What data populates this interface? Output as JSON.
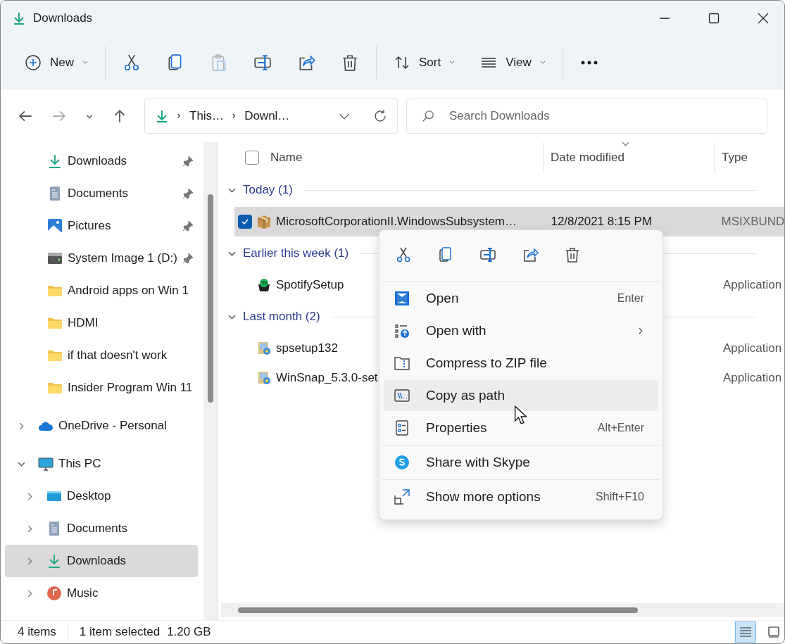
{
  "window": {
    "title": "Downloads"
  },
  "toolbar": {
    "new_label": "New",
    "sort_label": "Sort",
    "view_label": "View",
    "actions": [
      {
        "kind": "cut",
        "disabled": false
      },
      {
        "kind": "copy",
        "disabled": false
      },
      {
        "kind": "paste",
        "disabled": true
      },
      {
        "kind": "rename",
        "disabled": false
      },
      {
        "kind": "share",
        "disabled": false
      },
      {
        "kind": "delete",
        "disabled": false
      }
    ]
  },
  "address": {
    "crumbs": [
      "This…",
      "Downl…"
    ],
    "search_placeholder": "Search Downloads"
  },
  "sidebar": {
    "items": [
      {
        "label": "Downloads",
        "kind": "downloads",
        "pinned": true,
        "selected": false
      },
      {
        "label": "Documents",
        "kind": "documents",
        "pinned": true,
        "selected": false
      },
      {
        "label": "Pictures",
        "kind": "pictures",
        "pinned": true,
        "selected": false
      },
      {
        "label": "System Image 1 (D:)",
        "kind": "drive",
        "pinned": true,
        "selected": false
      },
      {
        "label": "Android apps on Win 1",
        "kind": "folder",
        "pinned": false,
        "selected": false
      },
      {
        "label": "HDMI",
        "kind": "folder",
        "pinned": false,
        "selected": false
      },
      {
        "label": "if that doesn't work",
        "kind": "folder",
        "pinned": false,
        "selected": false
      },
      {
        "label": "Insider Program Win 11",
        "kind": "folder",
        "pinned": false,
        "selected": false
      },
      {
        "label": "OneDrive - Personal",
        "kind": "cloud",
        "expanded": false,
        "selected": false
      },
      {
        "label": "This PC",
        "kind": "pc",
        "expanded": true,
        "selected": false,
        "children": [
          {
            "label": "Desktop",
            "kind": "desktop",
            "expanded": false,
            "selected": false
          },
          {
            "label": "Documents",
            "kind": "documents",
            "expanded": false,
            "selected": false
          },
          {
            "label": "Downloads",
            "kind": "downloads",
            "expanded": false,
            "selected": true
          },
          {
            "label": "Music",
            "kind": "music",
            "expanded": false,
            "selected": false
          }
        ]
      }
    ]
  },
  "columns": [
    "Name",
    "Date modified",
    "Type"
  ],
  "select_all": {
    "checked": false
  },
  "groups": [
    {
      "label": "Today (1)",
      "expanded": true,
      "files": [
        {
          "name": "MicrosoftCorporationII.WindowsSubsystem…",
          "date": "12/8/2021 8:15 PM",
          "type": "MSIXBUND",
          "kind": "package",
          "selected": true
        }
      ]
    },
    {
      "label": "Earlier this week (1)",
      "expanded": true,
      "files": [
        {
          "name": "SpotifySetup",
          "type": "Application",
          "kind": "spotify",
          "selected": false
        }
      ]
    },
    {
      "label": "Last month (2)",
      "expanded": true,
      "files": [
        {
          "name": "spsetup132",
          "type": "Application",
          "kind": "installer",
          "selected": false
        },
        {
          "name": "WinSnap_5.3.0-set",
          "type": "Application",
          "kind": "installer",
          "selected": false
        }
      ]
    }
  ],
  "context_menu": {
    "quick_actions": [
      {
        "kind": "cut"
      },
      {
        "kind": "copy"
      },
      {
        "kind": "rename"
      },
      {
        "kind": "share"
      },
      {
        "kind": "delete"
      }
    ],
    "sections": [
      [
        {
          "label": "Open",
          "shortcut": "Enter",
          "kind": "open",
          "submenu": false,
          "selected": false
        },
        {
          "label": "Open with",
          "kind": "openwith",
          "submenu": true,
          "selected": false
        },
        {
          "label": "Compress to ZIP file",
          "kind": "zip",
          "submenu": false,
          "selected": false
        },
        {
          "label": "Copy as path",
          "kind": "path",
          "submenu": false,
          "selected": true
        },
        {
          "label": "Properties",
          "shortcut": "Alt+Enter",
          "kind": "properties",
          "submenu": false,
          "selected": false
        }
      ],
      [
        {
          "label": "Share with Skype",
          "kind": "skype",
          "submenu": false,
          "selected": false
        }
      ],
      [
        {
          "label": "Show more options",
          "shortcut": "Shift+F10",
          "kind": "more",
          "submenu": false,
          "selected": false
        }
      ]
    ]
  },
  "status_bar": {
    "count": "4 items",
    "selection": "1 item selected",
    "size": "1.20 GB",
    "views": [
      {
        "kind": "details",
        "selected": true
      },
      {
        "kind": "tiles",
        "selected": false
      }
    ]
  }
}
